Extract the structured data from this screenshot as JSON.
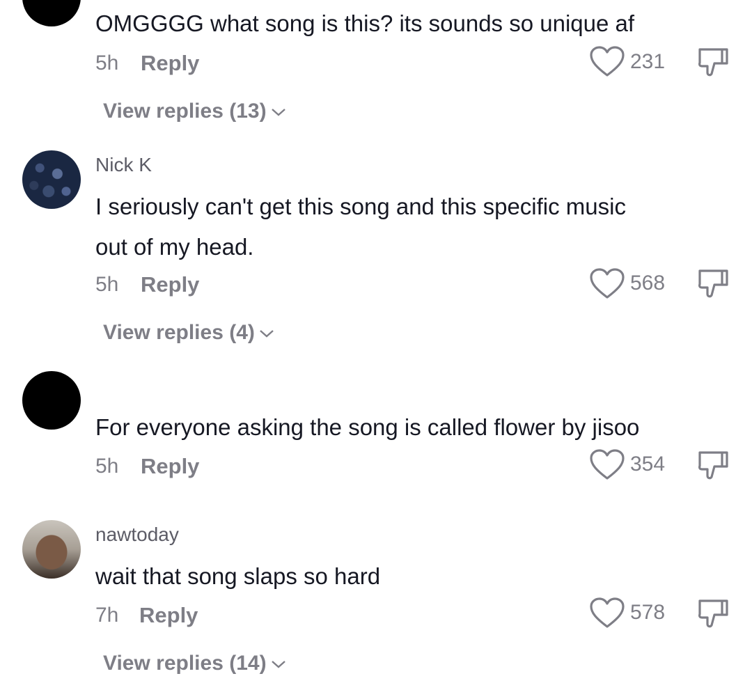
{
  "comments": [
    {
      "username": "",
      "text": "OMGGGG what song is this? its sounds so unique af",
      "time": "5h",
      "reply_label": "Reply",
      "likes": "231",
      "view_replies": "View replies (13)"
    },
    {
      "username": "Nick K",
      "text_line1": "I seriously can't get this song and this specific music",
      "text_line2": "out of my head.",
      "time": "5h",
      "reply_label": "Reply",
      "likes": "568",
      "view_replies": "View replies (4)"
    },
    {
      "username": "",
      "text": "For everyone asking the song is called flower by jisoo",
      "time": "5h",
      "reply_label": "Reply",
      "likes": "354"
    },
    {
      "username": "nawtoday",
      "text": "wait that song slaps so hard",
      "time": "7h",
      "reply_label": "Reply",
      "likes": "578",
      "view_replies": "View replies (14)"
    }
  ],
  "icons": {
    "like": "heart-outline-icon",
    "dislike": "thumbs-down-icon",
    "expand": "chevron-down-icon"
  },
  "colors": {
    "text_primary": "#161823",
    "text_secondary": "#7e7e86"
  }
}
